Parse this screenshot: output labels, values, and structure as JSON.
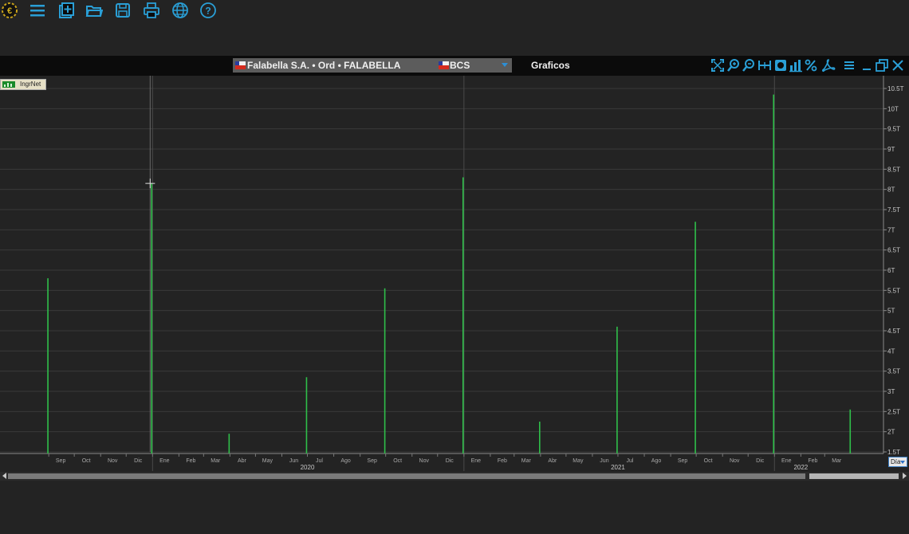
{
  "toolbar": {
    "instrument": "Falabella S.A. • Ord • FALABELLA",
    "exchange": "BCS",
    "window_title": "Graficos",
    "icons": [
      "app-logo-icon",
      "menu-icon",
      "new-icon",
      "open-folder-icon",
      "save-icon",
      "print-icon",
      "globe-icon",
      "help-icon"
    ],
    "right_icons": [
      "fit-icon",
      "zoom-in-icon",
      "zoom-out-icon",
      "range-icon",
      "color-icon",
      "chart-type-icon",
      "percent-icon",
      "pdf-icon",
      "list-icon",
      "minimize-icon",
      "restore-icon",
      "close-icon"
    ],
    "accent_color": "#2a9fd6"
  },
  "indicator": {
    "label": "IngrNet"
  },
  "period": {
    "label": "Día"
  },
  "chart_data": {
    "type": "bar",
    "series": [
      {
        "points": [
          {
            "date": "2019-08-31",
            "value": 5.8
          },
          {
            "date": "2019-12-31",
            "value": 8.15
          },
          {
            "date": "2020-03-31",
            "value": 1.95
          },
          {
            "date": "2020-06-30",
            "value": 3.35
          },
          {
            "date": "2020-09-30",
            "value": 5.55
          },
          {
            "date": "2020-12-31",
            "value": 8.3
          },
          {
            "date": "2021-03-31",
            "value": 2.25
          },
          {
            "date": "2021-06-30",
            "value": 4.6
          },
          {
            "date": "2021-09-30",
            "value": 7.2
          },
          {
            "date": "2021-12-31",
            "value": 10.35
          },
          {
            "date": "2022-03-31",
            "value": 2.55
          }
        ]
      }
    ],
    "y_ticks": [
      "1.5T",
      "2T",
      "2.5T",
      "3T",
      "3.5T",
      "4T",
      "4.5T",
      "5T",
      "5.5T",
      "6T",
      "6.5T",
      "7T",
      "7.5T",
      "8T",
      "8.5T",
      "9T",
      "9.5T",
      "10T",
      "10.5T"
    ],
    "ylim": [
      1.5,
      10.5
    ],
    "y_unit": "T",
    "months": [
      {
        "date": "2019-09",
        "label": "Sep"
      },
      {
        "date": "2019-10",
        "label": "Oct"
      },
      {
        "date": "2019-11",
        "label": "Nov"
      },
      {
        "date": "2019-12",
        "label": "Dic"
      },
      {
        "date": "2020-01",
        "label": "Ene"
      },
      {
        "date": "2020-02",
        "label": "Feb"
      },
      {
        "date": "2020-03",
        "label": "Mar"
      },
      {
        "date": "2020-04",
        "label": "Abr"
      },
      {
        "date": "2020-05",
        "label": "May"
      },
      {
        "date": "2020-06",
        "label": "Jun"
      },
      {
        "date": "2020-07",
        "label": "Jul"
      },
      {
        "date": "2020-08",
        "label": "Ago"
      },
      {
        "date": "2020-09",
        "label": "Sep"
      },
      {
        "date": "2020-10",
        "label": "Oct"
      },
      {
        "date": "2020-11",
        "label": "Nov"
      },
      {
        "date": "2020-12",
        "label": "Dic"
      },
      {
        "date": "2021-01",
        "label": "Ene"
      },
      {
        "date": "2021-02",
        "label": "Feb"
      },
      {
        "date": "2021-03",
        "label": "Mar"
      },
      {
        "date": "2021-04",
        "label": "Abr"
      },
      {
        "date": "2021-05",
        "label": "May"
      },
      {
        "date": "2021-06",
        "label": "Jun"
      },
      {
        "date": "2021-07",
        "label": "Jul"
      },
      {
        "date": "2021-08",
        "label": "Ago"
      },
      {
        "date": "2021-09",
        "label": "Sep"
      },
      {
        "date": "2021-10",
        "label": "Oct"
      },
      {
        "date": "2021-11",
        "label": "Nov"
      },
      {
        "date": "2021-12",
        "label": "Dic"
      },
      {
        "date": "2022-01",
        "label": "Ene"
      },
      {
        "date": "2022-02",
        "label": "Feb"
      },
      {
        "date": "2022-03",
        "label": "Mar"
      }
    ],
    "years": [
      {
        "date": "2020-07",
        "label": "2020"
      },
      {
        "date": "2021-07",
        "label": "2021"
      },
      {
        "date": "2022-02",
        "label": "2022"
      }
    ],
    "crosshair_date": "2020-01",
    "bar_color": "#2fbf4a",
    "grid": true
  }
}
